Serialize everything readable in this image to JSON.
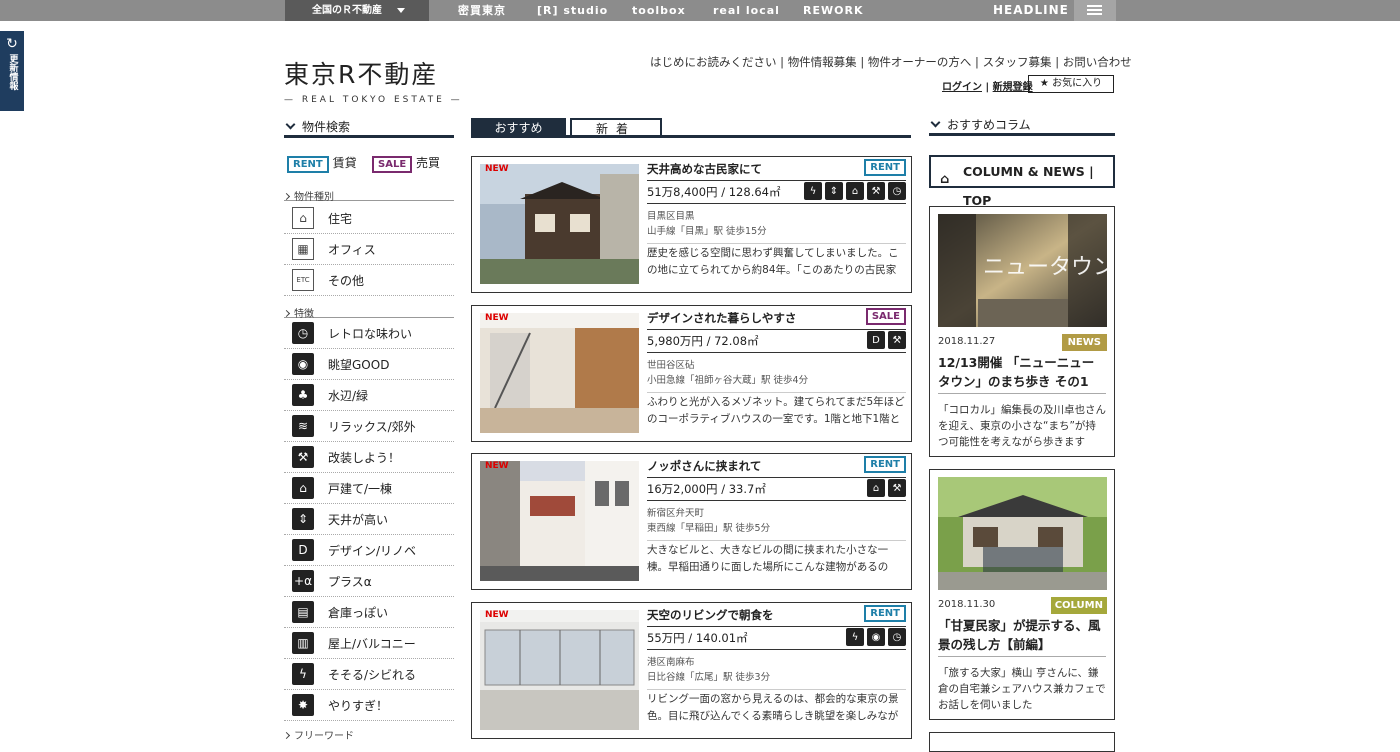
{
  "topnav": {
    "region": "全国のＲ不動産",
    "items": [
      "密買東京",
      "[R] studio",
      "toolbox",
      "real local",
      "REWORK"
    ],
    "headline": "HEADLINE"
  },
  "sidetab": {
    "label": "更新情報",
    "icon": "refresh-icon"
  },
  "logo": {
    "jp": "東京R不動産",
    "en": "— REAL TOKYO ESTATE —"
  },
  "header_links": {
    "items": [
      "はじめにお読みください",
      "物件情報募集",
      "物件オーナーの方へ",
      "スタッフ募集",
      "お問い合わせ"
    ],
    "separator": " | ",
    "login": "ログイン",
    "register": "新規登録",
    "favorites": "★ お気に入り"
  },
  "search": {
    "heading": "物件検索",
    "rent_badge": "RENT",
    "rent_label": "賃貸",
    "sale_badge": "SALE",
    "sale_label": "売買",
    "type_heading": "物件種別",
    "types": [
      {
        "label": "住宅",
        "icon": "house-icon",
        "glyph": "⌂"
      },
      {
        "label": "オフィス",
        "icon": "office-building-icon",
        "glyph": "▦"
      },
      {
        "label": "その他",
        "icon": "etc-icon",
        "glyph": "ETC"
      }
    ],
    "feature_heading": "特徴",
    "features": [
      {
        "label": "レトロな味わい",
        "icon": "retro-clock-icon",
        "glyph": "◷"
      },
      {
        "label": "眺望GOOD",
        "icon": "view-eye-icon",
        "glyph": "◉"
      },
      {
        "label": "水辺/緑",
        "icon": "waterside-icon",
        "glyph": "♣"
      },
      {
        "label": "リラックス/郊外",
        "icon": "relax-icon",
        "glyph": "≋"
      },
      {
        "label": "改装しよう！",
        "icon": "renovate-drill-icon",
        "glyph": "⚒"
      },
      {
        "label": "戸建て/一棟",
        "icon": "detached-house-icon",
        "glyph": "⌂"
      },
      {
        "label": "天井が高い",
        "icon": "high-ceiling-icon",
        "glyph": "⇕"
      },
      {
        "label": "デザイン/リノベ",
        "icon": "design-d-icon",
        "glyph": "D"
      },
      {
        "label": "プラスα",
        "icon": "plus-alpha-icon",
        "glyph": "+α"
      },
      {
        "label": "倉庫っぽい",
        "icon": "warehouse-icon",
        "glyph": "▤"
      },
      {
        "label": "屋上/バルコニー",
        "icon": "rooftop-icon",
        "glyph": "▥"
      },
      {
        "label": "そそる/シビれる",
        "icon": "lightning-icon",
        "glyph": "ϟ"
      },
      {
        "label": "やりすぎ！",
        "icon": "burst-icon",
        "glyph": "✸"
      }
    ],
    "freeword_heading": "フリーワード"
  },
  "tabs": {
    "recommended": "おすすめ",
    "new": "新着"
  },
  "listings": [
    {
      "new_label": "NEW",
      "title": "天井高めな古民家にて",
      "type": "RENT",
      "price": "51万8,400円 / 128.64㎡",
      "area": "目黒区目黒",
      "station": "山手線「目黒」駅 徒歩15分",
      "desc": "歴史を感じる空間に思わず興奮してしまいました。この地に立てられてから約84年。「このあたりの古民家の",
      "features": [
        "ϟ",
        "⇕",
        "⌂",
        "⚒",
        "◷"
      ]
    },
    {
      "new_label": "NEW",
      "title": "デザインされた暮らしやすさ",
      "type": "SALE",
      "price": "5,980万円 / 72.08㎡",
      "area": "世田谷区砧",
      "station": "小田急線「祖師ヶ谷大蔵」駅 徒歩4分",
      "desc": "ふわりと光が入るメゾネット。建てられてまだ5年ほどのコーポラティブハウスの一室です。1階と地下1階と",
      "features": [
        "D",
        "⚒"
      ]
    },
    {
      "new_label": "NEW",
      "title": "ノッポさんに挟まれて",
      "type": "RENT",
      "price": "16万2,000円 / 33.7㎡",
      "area": "新宿区弁天町",
      "station": "東西線「早稲田」駅 徒歩5分",
      "desc": "大きなビルと、大きなビルの間に挟まれた小さな一棟。早稲田通りに面した場所にこんな建物があるのは、良い",
      "features": [
        "⌂",
        "⚒"
      ]
    },
    {
      "new_label": "NEW",
      "title": "天空のリビングで朝食を",
      "type": "RENT",
      "price": "55万円 / 140.01㎡",
      "area": "港区南麻布",
      "station": "日比谷線「広尾」駅 徒歩3分",
      "desc": "リビング一面の窓から見えるのは、都会的な東京の景色。目に飛び込んでくる素晴らしき眺望を楽しみながら",
      "features": [
        "ϟ",
        "◉",
        "◷"
      ]
    }
  ],
  "columns": {
    "heading": "おすすめコラム",
    "top_button": "COLUMN & NEWS | TOP",
    "items": [
      {
        "date": "2018.11.27",
        "badge": "NEWS",
        "title": "12/13開催 「ニューニュータウン」のまち歩き その1",
        "desc": "「コロカル」編集長の及川卓也さんを迎え、東京の小さな“まち”が持つ可能性を考えながら歩きます",
        "pic_text": "ニュータウン"
      },
      {
        "date": "2018.11.30",
        "badge": "COLUMN",
        "title": "「甘夏民家」が提示する、風景の残し方【前編】",
        "desc": "「旅する大家」横山 亨さんに、鎌倉の自宅兼シェアハウス兼カフェでお話しを伺いました"
      }
    ]
  },
  "colors": {
    "navy": "#1f2d3d",
    "rent": "#1e7fa8",
    "sale": "#7a2a6e",
    "news": "#b19b45",
    "column": "#a5a83b",
    "topbar": "#8c8c8c"
  }
}
